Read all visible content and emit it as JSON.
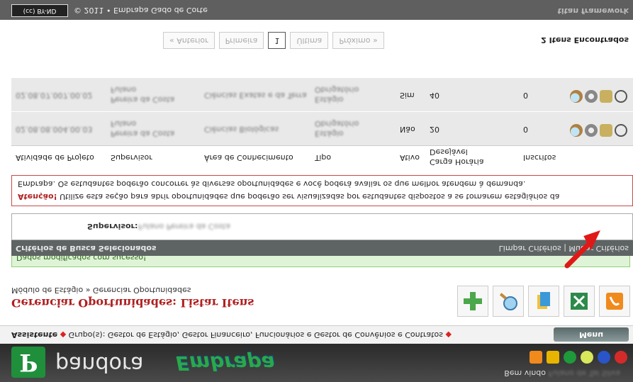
{
  "header": {
    "logo_letter": "P",
    "app_name": "pandora",
    "brand": "Embrapa",
    "welcome": "Bem vindo",
    "user_name": "Fulano de Tal Silva"
  },
  "groupbar": {
    "assistente": "Assistente",
    "groups": "Grupo(s): Gestor de Estágio, Gestor Financeiro, Funcionários e Gestor de Convênios e Contratos",
    "menu_label": "Menu"
  },
  "title": {
    "breadcrumb": "Módulo de Estágio » Gerenciar Oportunidades",
    "page_title": "Gerenciar Oportunidades: Listar Itens"
  },
  "success_message": "Dados modificados com sucesso!",
  "criteria": {
    "title": "Critérios de Busca Selecionados",
    "clear_label": "Limpar Critérios",
    "change_label": "Mudar Critérios",
    "separator": "|",
    "supervisor_label": "Supervisor:",
    "supervisor_value": "Fulano Pereira da Costa"
  },
  "attention": {
    "label": "Atenção!",
    "line1": "Utilize esta seção para abrir oportunidades que poderão ser visualizadas por estudantes dispostos a se tornarem estagiários da",
    "line2": "Embrapa. Os estudantes poderão concorrer às diversas oportunidades e você poderá avaliar os que melhor atendem à demanda."
  },
  "table": {
    "headers": {
      "activity": "Atividade de Projeto",
      "supervisor": "Supervisor",
      "area": "Área de Conhecimento",
      "type": "Tipo",
      "active": "Ativo",
      "workload_desired": "Desejável",
      "workload": "Carga Horária",
      "enrolled": "Inscritos"
    },
    "rows": [
      {
        "activity": "02.08.08.004.00.03",
        "supervisor_1": "Fulano",
        "supervisor_2": "Pereira da Costa",
        "area": "Ciências Biológicas",
        "type_1": "Estágio",
        "type_2": "Obrigatório",
        "active": "Não",
        "workload": "20",
        "enrolled": "0"
      },
      {
        "activity": "02.08.07.007.00.02",
        "supervisor_1": "Fulano",
        "supervisor_2": "Pereira da Costa",
        "area": "Ciências Exatas e da Terra",
        "type_1": "Estágio",
        "type_2": "Obrigatório",
        "active": "Sim",
        "workload": "40",
        "enrolled": "0"
      }
    ]
  },
  "pager": {
    "previous": "« Anterior",
    "first": "Primeira",
    "current": "1",
    "last": "Última",
    "next": "Próximo »",
    "found": "2 Itens Encontrados"
  },
  "footer": {
    "cc_badge": "BY-ND",
    "copyright": "© 2011 • Embrapa Gado de Corte",
    "powered": "titan framework"
  },
  "colors": {
    "header_bg": "#2a2a2a",
    "brand_green": "#1f8f3c",
    "title_red": "#b02020",
    "success_bg": "#dff3d6",
    "row_bg": "#e9e9e9"
  }
}
